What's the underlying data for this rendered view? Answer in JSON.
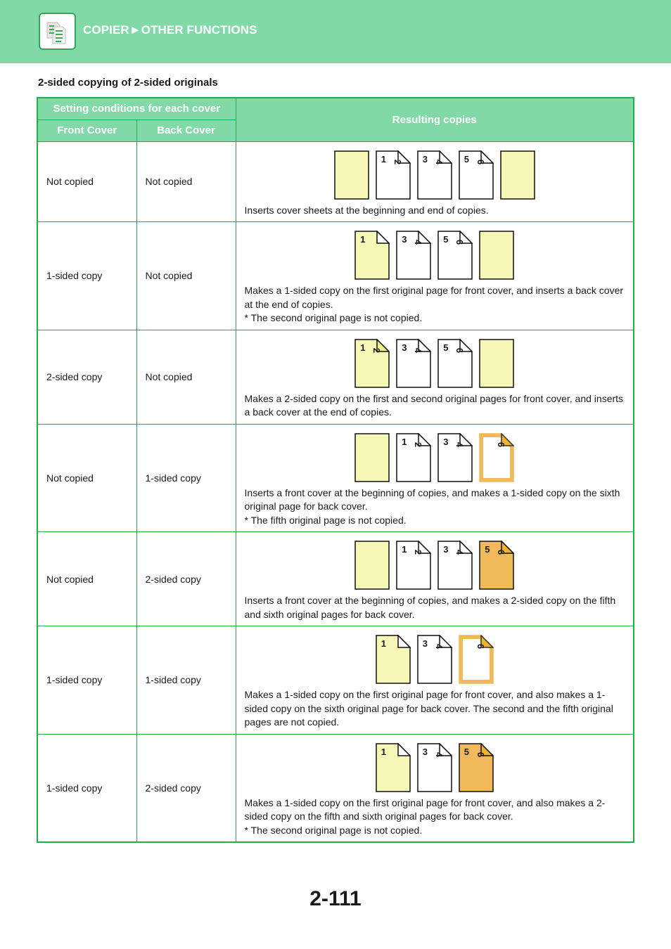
{
  "header": {
    "title": "COPIER►OTHER FUNCTIONS",
    "icon": "copier-icon",
    "bg_color": "#80d9a7"
  },
  "section_title": "2-sided copying of 2-sided originals",
  "table": {
    "header_group": "Setting conditions for each cover",
    "col_front": "Front Cover",
    "col_back": "Back Cover",
    "col_result": "Resulting copies",
    "rows": [
      {
        "front": "Not copied",
        "back": "Not copied",
        "pages": [
          {
            "type": "cover"
          },
          {
            "type": "plain",
            "front": "1",
            "back": "2"
          },
          {
            "type": "plain",
            "front": "3",
            "back": "4"
          },
          {
            "type": "plain",
            "front": "5",
            "back": "6"
          },
          {
            "type": "cover"
          }
        ],
        "desc": [
          "Inserts cover sheets at the beginning and end of copies."
        ]
      },
      {
        "front": "1-sided copy",
        "back": "Not copied",
        "pages": [
          {
            "type": "cover-printed1",
            "front": "1"
          },
          {
            "type": "plain",
            "front": "3",
            "back": "4"
          },
          {
            "type": "plain",
            "front": "5",
            "back": "6"
          },
          {
            "type": "cover"
          }
        ],
        "desc": [
          "Makes a 1-sided copy on the first original page for front cover, and inserts a back cover at the end of copies.",
          "* The second original page is not copied."
        ]
      },
      {
        "front": "2-sided copy",
        "back": "Not copied",
        "pages": [
          {
            "type": "cover-printed2",
            "front": "1",
            "back": "2"
          },
          {
            "type": "plain",
            "front": "3",
            "back": "4"
          },
          {
            "type": "plain",
            "front": "5",
            "back": "6"
          },
          {
            "type": "cover"
          }
        ],
        "desc": [
          "Makes a 2-sided copy on the first and second original pages for front cover, and inserts a back cover at the end of copies."
        ]
      },
      {
        "front": "Not copied",
        "back": "1-sided copy",
        "pages": [
          {
            "type": "cover"
          },
          {
            "type": "plain",
            "front": "1",
            "back": "2"
          },
          {
            "type": "plain",
            "front": "3",
            "back": "4"
          },
          {
            "type": "back-printed1",
            "back": "6"
          }
        ],
        "desc": [
          "Inserts a front cover at the beginning of copies, and makes a 1-sided copy on the sixth original page for back cover.",
          "* The fifth original page is not copied."
        ]
      },
      {
        "front": "Not copied",
        "back": "2-sided copy",
        "pages": [
          {
            "type": "cover"
          },
          {
            "type": "plain",
            "front": "1",
            "back": "2"
          },
          {
            "type": "plain",
            "front": "3",
            "back": "4"
          },
          {
            "type": "back-printed2",
            "front": "5",
            "back": "6"
          }
        ],
        "desc": [
          "Inserts a front cover at the beginning of copies, and makes a 2-sided copy on the fifth and sixth original pages for back cover."
        ]
      },
      {
        "front": "1-sided copy",
        "back": "1-sided copy",
        "pages": [
          {
            "type": "cover-printed1",
            "front": "1"
          },
          {
            "type": "plain",
            "front": "3",
            "back": "4"
          },
          {
            "type": "back-printed1",
            "back": "6"
          }
        ],
        "desc": [
          "Makes a 1-sided copy on the first original page for front cover, and also makes a 1-sided copy on the sixth original page for back cover. The second and the fifth original pages are not copied."
        ]
      },
      {
        "front": "1-sided copy",
        "back": "2-sided copy",
        "pages": [
          {
            "type": "cover-printed1",
            "front": "1"
          },
          {
            "type": "plain",
            "front": "3",
            "back": "4"
          },
          {
            "type": "back-printed2",
            "front": "5",
            "back": "6"
          }
        ],
        "desc": [
          "Makes a 1-sided copy on the first original page for front cover, and also makes a 2-sided copy on the fifth and sixth original pages for back cover.",
          "* The second original page is not copied."
        ]
      }
    ]
  },
  "colors": {
    "cover": "#f7f7b8",
    "back_cover": "#f0b95a",
    "back_corner": "#f0b429",
    "border": "#1fae4b"
  },
  "page_number": "2-111"
}
